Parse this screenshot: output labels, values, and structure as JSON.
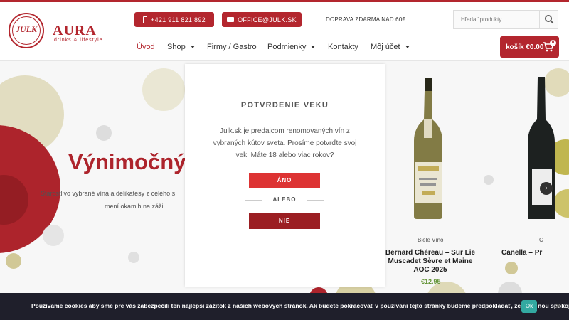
{
  "header": {
    "logo_julk": "JULK",
    "logo_aura": "AURA",
    "logo_aura_sub": "drinks & lifestyle",
    "phone": "+421 911 821 892",
    "email": "OFFICE@JULK.SK",
    "shipping": "DOPRAVA ZDARMA NAD 60€",
    "search_placeholder": "Hľadať produkty",
    "nav": {
      "uvod": "Úvod",
      "shop": "Shop",
      "firmy": "Firmy / Gastro",
      "podmienky": "Podmienky",
      "kontakty": "Kontakty",
      "ucet": "Môj účet"
    },
    "cart_label": "košík €0.00",
    "cart_count": "0"
  },
  "hero": {
    "title": "Výnimočný",
    "text_line1": "Starostlivo vybrané vína a delikatesy z celého s",
    "text_line2": "mení okamih na záži"
  },
  "products": [
    {
      "category": "Biele Víno",
      "name": "Bernard Chéreau – Sur Lie Muscadet Sèvre et Maine AOC 2025",
      "price": "€12.95"
    },
    {
      "category": "C",
      "name": "Canella – Pr",
      "price": ""
    }
  ],
  "modal": {
    "title": "POTVRDENIE VEKU",
    "text": "Julk.sk je predajcom renomovaných vín z vybraných kútov sveta. Prosíme potvrďte svoj vek. Máte 18 alebo viac rokov?",
    "yes": "ÁNO",
    "or": "ALEBO",
    "no": "NIE"
  },
  "cookie": {
    "text": "Používame cookies aby sme pre vás zabezpečili ten najlepší zážitok z našich webových stránok. Ak budete pokračovať v používaní tejto stránky budeme predpokladať, že ste s ňou spokojní.",
    "ok": "Ok",
    "close": "✕"
  },
  "colors": {
    "brand": "#b3262e",
    "yes_button": "#dd3333",
    "no_button": "#9b1e22",
    "cookie_bg": "#1f1f2b",
    "ok_button": "#33a9a1",
    "price": "#6a9b3c"
  }
}
